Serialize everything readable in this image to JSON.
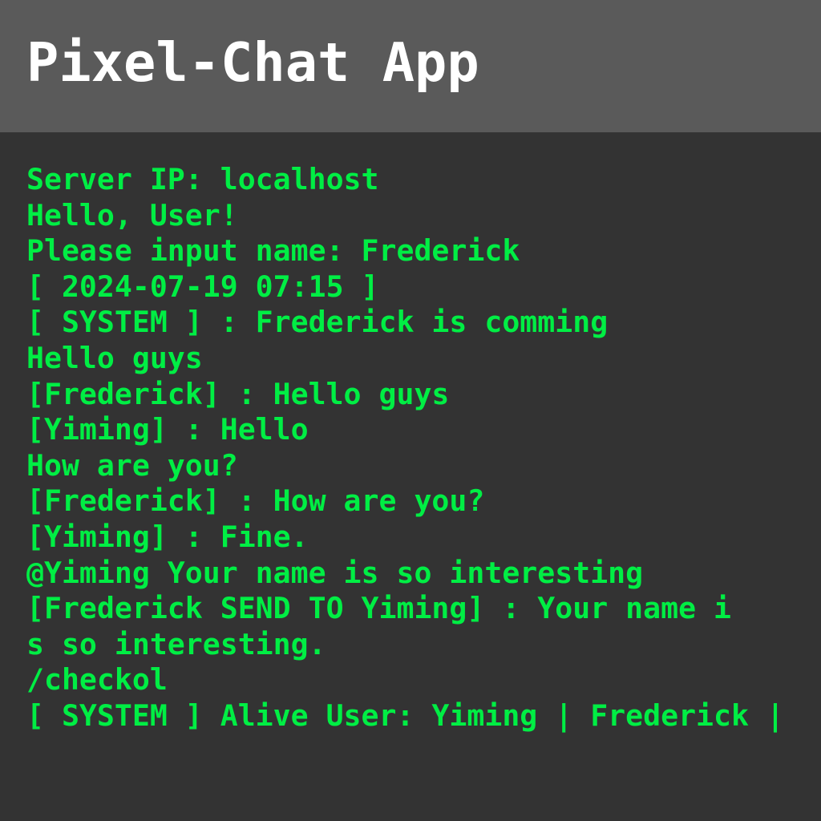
{
  "app": {
    "title": "Pixel-Chat App"
  },
  "colors": {
    "header_bg": "#5a5a5a",
    "body_bg": "#333333",
    "title_text": "#ffffff",
    "console_text": "#00ee44"
  },
  "console": {
    "lines": [
      "Server IP: localhost",
      "Hello, User!",
      "Please input name: Frederick",
      "[ 2024-07-19 07:15 ]",
      "[ SYSTEM ] : Frederick is comming",
      "Hello guys",
      "[Frederick] : Hello guys",
      "[Yiming] : Hello",
      "How are you?",
      "[Frederick] : How are you?",
      "[Yiming] : Fine.",
      "@Yiming Your name is so interesting",
      "[Frederick SEND TO Yiming] : Your name i",
      "s so interesting.",
      "/checkol",
      "[ SYSTEM ] Alive User: Yiming | Frederick |"
    ]
  }
}
